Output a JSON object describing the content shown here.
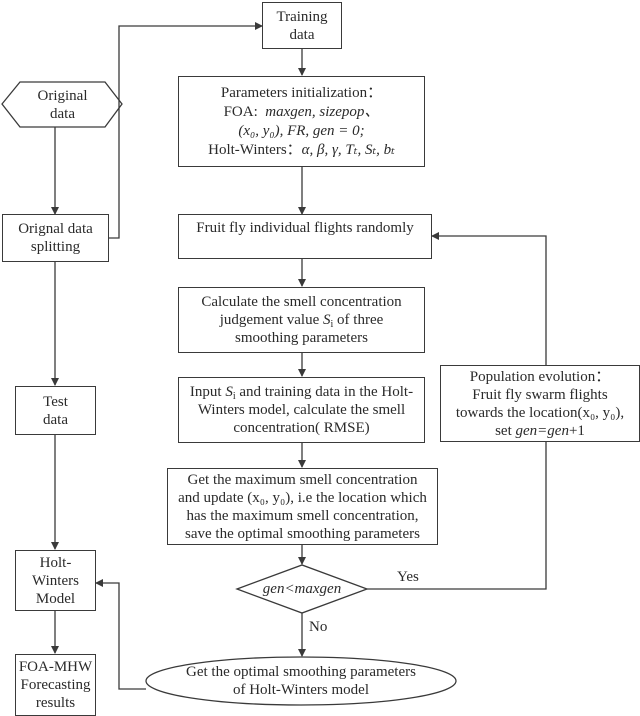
{
  "nodes": {
    "original_data": {
      "lines": [
        "Original",
        "data"
      ]
    },
    "orignal_data_splitting": {
      "lines": [
        "Orignal data",
        "splitting"
      ]
    },
    "test_data": {
      "lines": [
        "Test",
        "data"
      ]
    },
    "holt_winters_model": {
      "lines": [
        "Holt-",
        "Winters",
        "Model"
      ]
    },
    "foa_mhw_results": {
      "lines": [
        "FOA-MHW",
        "Forecasting",
        "results"
      ]
    },
    "training_data": {
      "lines": [
        "Training",
        "data"
      ]
    },
    "parameters_init": {
      "title": "Parameters initialization：",
      "foa_prefix": "FOA:",
      "foa_params": "maxgen, sizepop、",
      "foa_params2": "(x₀, y₀), FR, gen = 0;",
      "hw_prefix": "Holt-Winters：",
      "hw_params": "α, β, γ, Tₜ, Sₜ, bₜ"
    },
    "fly_randomly": {
      "lines": [
        "Fruit fly individual flights randomly"
      ]
    },
    "calc_judgement": {
      "line1": "Calculate the smell  concentration",
      "line2_pre": "judgement value ",
      "line2_var": "S",
      "line2_sub": "i",
      "line2_post": " of three",
      "line3": "smoothing parameters"
    },
    "input_si": {
      "line1_pre": "Input ",
      "line1_var": "S",
      "line1_sub": "i",
      "line1_post": " and training data in the Holt-",
      "line2": "Winters model, calculate the  smell",
      "line3": "concentration( RMSE)"
    },
    "get_maximum": {
      "line1": "Get the maximum smell  concentration",
      "line2": "and update (x₀, y₀), i.e the location which",
      "line3": "has the maximum smell  concentration,",
      "line4": "save the optimal smoothing parameters"
    },
    "decision": {
      "text": "gen<maxgen"
    },
    "population_evolution": {
      "line1": "Population evolution：",
      "line2": "Fruit fly swarm flights",
      "line3": "towards the location(x₀, y₀),",
      "line4_pre": "set ",
      "line4_var": "gen=gen",
      "line4_post": "+1"
    },
    "get_optimal": {
      "lines": [
        "Get the optimal smoothing parameters",
        "of Holt-Winters model"
      ]
    }
  },
  "edge_labels": {
    "yes": "Yes",
    "no": "No"
  },
  "colors": {
    "stroke": "#3a3a3a",
    "text": "#2a2a2a",
    "background": "#ffffff"
  }
}
